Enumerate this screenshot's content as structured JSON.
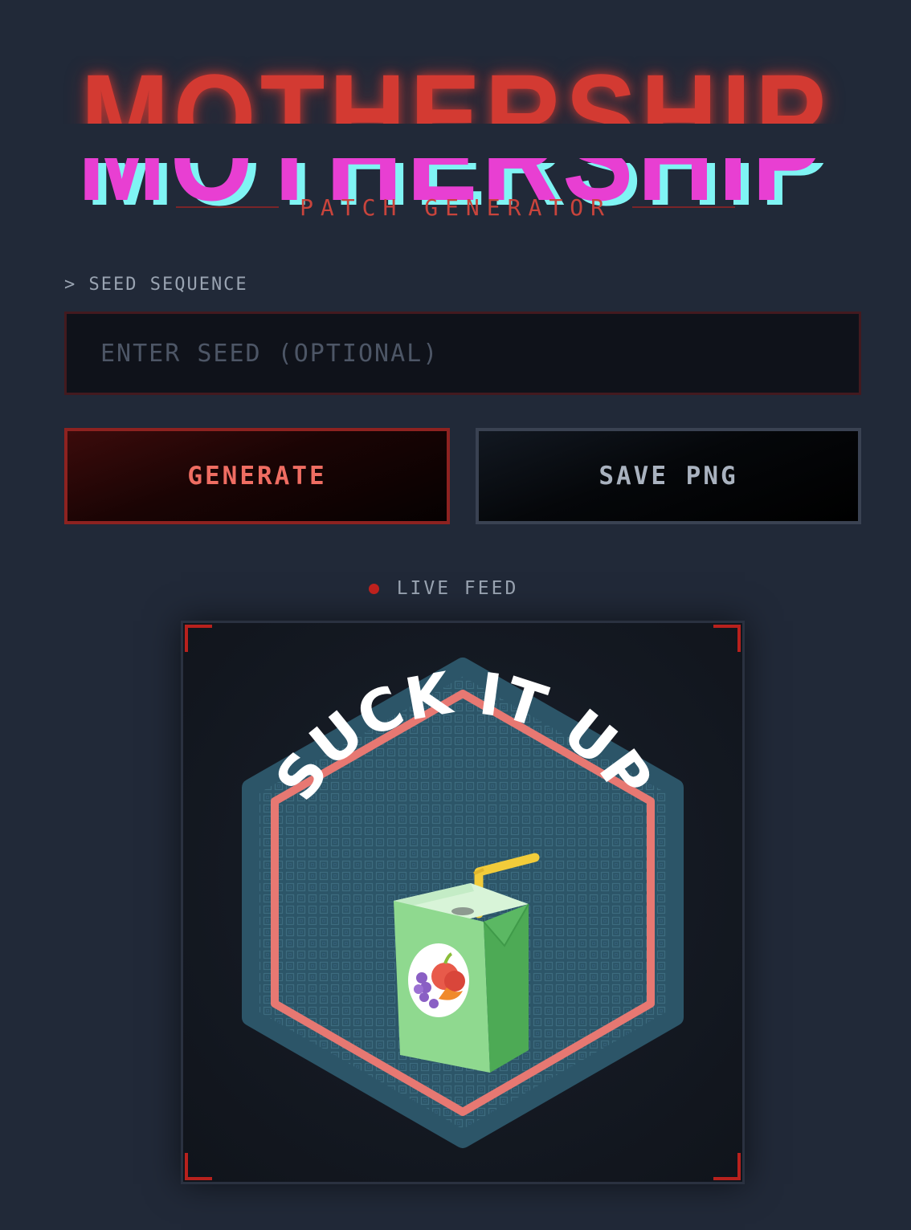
{
  "header": {
    "title": "MOTHERSHIP",
    "subtitle": "PATCH GENERATOR"
  },
  "seed": {
    "label": "> SEED SEQUENCE",
    "value": "",
    "placeholder": "ENTER SEED (OPTIONAL)"
  },
  "actions": {
    "generate_label": "GENERATE",
    "save_label": "SAVE PNG"
  },
  "preview": {
    "status_label": "LIVE FEED",
    "patch_text": "SUCK IT UP",
    "patch_icon": "juice-box-icon"
  },
  "colors": {
    "background": "#212938",
    "accent_red": "#d33a32",
    "glitch_cyan": "#7ff4f4",
    "glitch_magenta": "#e83fd2",
    "patch_fill": "#2c5568",
    "patch_border": "#e77872"
  }
}
